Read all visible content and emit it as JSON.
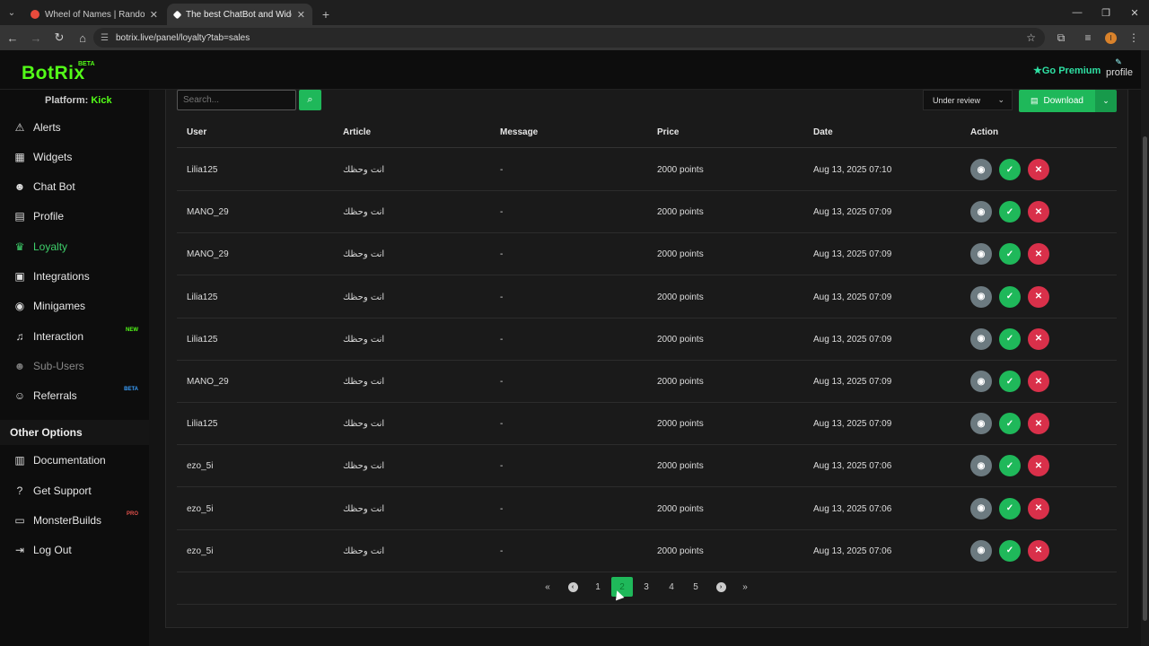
{
  "browser": {
    "tabs": [
      {
        "title": "Wheel of Names | Random nam",
        "active": false,
        "favicon_color": "#e94b3c"
      },
      {
        "title": "The best ChatBot and Widgets",
        "active": true,
        "favicon_color": "#ffffff"
      }
    ],
    "url": "botrix.live/panel/loyalty?tab=sales",
    "profile_initial": "I"
  },
  "header": {
    "logo": "BotRix",
    "logo_badge": "BETA",
    "premium_label": "Go Premium",
    "profile_label": "profile"
  },
  "sidebar": {
    "platform_label": "Platform:",
    "platform_value": "Kick",
    "items": [
      {
        "label": "Alerts",
        "icon": "warning-icon",
        "glyph": "⚠",
        "tag": ""
      },
      {
        "label": "Widgets",
        "icon": "grid-icon",
        "glyph": "▦",
        "tag": ""
      },
      {
        "label": "Chat Bot",
        "icon": "robot-icon",
        "glyph": "☻",
        "tag": ""
      },
      {
        "label": "Profile",
        "icon": "id-card-icon",
        "glyph": "▤",
        "tag": ""
      },
      {
        "label": "Loyalty",
        "icon": "trophy-icon",
        "glyph": "🏆",
        "tag": ""
      },
      {
        "label": "Integrations",
        "icon": "plug-icon",
        "glyph": "▣",
        "tag": ""
      },
      {
        "label": "Minigames",
        "icon": "gamepad-icon",
        "glyph": "◉",
        "tag": ""
      },
      {
        "label": "Interaction",
        "icon": "music-icon",
        "glyph": "♫",
        "tag": "NEW"
      },
      {
        "label": "Sub-Users",
        "icon": "robot-icon",
        "glyph": "☻",
        "tag": ""
      },
      {
        "label": "Referrals",
        "icon": "users-icon",
        "glyph": "👥",
        "tag": "BETA"
      }
    ],
    "other_header": "Other Options",
    "other_items": [
      {
        "label": "Documentation",
        "icon": "scroll-icon",
        "glyph": "▥",
        "tag": ""
      },
      {
        "label": "Get Support",
        "icon": "question-icon",
        "glyph": "?",
        "tag": ""
      },
      {
        "label": "MonsterBuilds",
        "icon": "laptop-icon",
        "glyph": "▭",
        "tag": "PRO"
      },
      {
        "label": "Log Out",
        "icon": "logout-icon",
        "glyph": "⇥",
        "tag": ""
      }
    ]
  },
  "toolbar": {
    "search_placeholder": "Search...",
    "status_filter": "Under review",
    "download_label": "Download"
  },
  "table": {
    "columns": [
      "User",
      "Article",
      "Message",
      "Price",
      "Date",
      "Action"
    ],
    "rows": [
      {
        "user": "Lilia125",
        "article": "انت وحظك",
        "message": "-",
        "price": "2000 points",
        "date": "Aug 13, 2025 07:10"
      },
      {
        "user": "MANO_29",
        "article": "انت وحظك",
        "message": "-",
        "price": "2000 points",
        "date": "Aug 13, 2025 07:09"
      },
      {
        "user": "MANO_29",
        "article": "انت وحظك",
        "message": "-",
        "price": "2000 points",
        "date": "Aug 13, 2025 07:09"
      },
      {
        "user": "Lilia125",
        "article": "انت وحظك",
        "message": "-",
        "price": "2000 points",
        "date": "Aug 13, 2025 07:09"
      },
      {
        "user": "Lilia125",
        "article": "انت وحظك",
        "message": "-",
        "price": "2000 points",
        "date": "Aug 13, 2025 07:09"
      },
      {
        "user": "MANO_29",
        "article": "انت وحظك",
        "message": "-",
        "price": "2000 points",
        "date": "Aug 13, 2025 07:09"
      },
      {
        "user": "Lilia125",
        "article": "انت وحظك",
        "message": "-",
        "price": "2000 points",
        "date": "Aug 13, 2025 07:09"
      },
      {
        "user": "ezo_5i",
        "article": "انت وحظك",
        "message": "-",
        "price": "2000 points",
        "date": "Aug 13, 2025 07:06"
      },
      {
        "user": "ezo_5i",
        "article": "انت وحظك",
        "message": "-",
        "price": "2000 points",
        "date": "Aug 13, 2025 07:06"
      },
      {
        "user": "ezo_5i",
        "article": "انت وحظك",
        "message": "-",
        "price": "2000 points",
        "date": "Aug 13, 2025 07:06"
      }
    ]
  },
  "pagination": {
    "pages": [
      "1",
      "2",
      "3",
      "4",
      "5"
    ],
    "current": "2"
  },
  "colors": {
    "accent": "#1fb85a",
    "kick_green": "#53fc18",
    "reject": "#d9304a",
    "view": "#6c7a80"
  }
}
